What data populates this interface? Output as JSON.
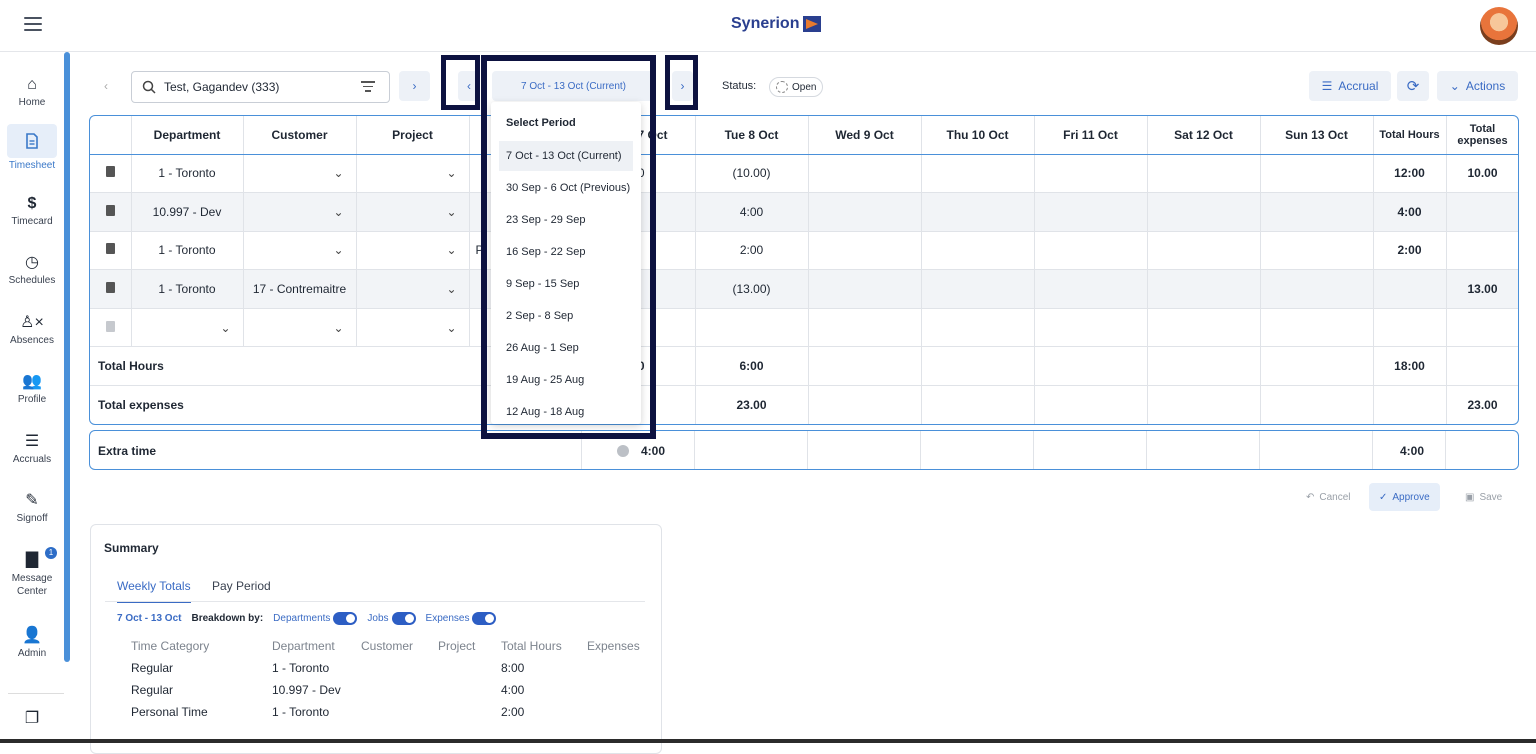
{
  "app": {
    "logo_text": "Synerion"
  },
  "sidebar": {
    "items": [
      {
        "label": "Home",
        "icon": "home-icon"
      },
      {
        "label": "Timesheet",
        "icon": "document-icon"
      },
      {
        "label": "Timecard",
        "icon": "dollar-icon"
      },
      {
        "label": "Schedules",
        "icon": "clock-icon"
      },
      {
        "label": "Absences",
        "icon": "person-x-icon"
      },
      {
        "label": "Profile",
        "icon": "people-icon"
      },
      {
        "label": "Accruals",
        "icon": "accruals-icon"
      },
      {
        "label": "Signoff",
        "icon": "signoff-icon"
      },
      {
        "label": "Message Center",
        "icon": "message-icon",
        "badge": "1"
      },
      {
        "label": "Admin",
        "icon": "admin-icon"
      }
    ]
  },
  "toolbar": {
    "employee_value": "Test, Gagandev (333)",
    "period_label": "7 Oct - 13 Oct (Current)",
    "status_label": "Status:",
    "status_value": "Open",
    "accrual_label": "Accrual",
    "actions_label": "Actions"
  },
  "grid": {
    "headers": [
      "Department",
      "Customer",
      "Project",
      "",
      "Mon 7 Oct",
      "Tue 8 Oct",
      "Wed 9 Oct",
      "Thu 10 Oct",
      "Fri 11 Oct",
      "Sat 12 Oct",
      "Sun 13 Oct",
      "Total Hours",
      "Total expenses"
    ],
    "rows": [
      {
        "department": "1 - Toronto",
        "customer": "",
        "mon": "00",
        "tue": "(10.00)",
        "total_hours": "12:00",
        "total_expenses": "10.00"
      },
      {
        "department": "10.997 - Dev",
        "customer": "",
        "mon": "",
        "tue": "4:00",
        "total_hours": "4:00",
        "total_expenses": ""
      },
      {
        "department": "1 - Toronto",
        "customer": "",
        "extra": "P",
        "mon": "",
        "tue": "2:00",
        "total_hours": "2:00",
        "total_expenses": ""
      },
      {
        "department": "1 - Toronto",
        "customer": "17 - Contremaitre",
        "mon": "",
        "tue": "(13.00)",
        "total_hours": "",
        "total_expenses": "13.00"
      },
      {
        "department": "",
        "customer": "",
        "mon": "",
        "tue": "",
        "total_hours": "",
        "total_expenses": ""
      }
    ],
    "total_hours": {
      "label": "Total Hours",
      "mon": "00",
      "tue": "6:00",
      "total": "18:00"
    },
    "total_expenses": {
      "label": "Total expenses",
      "tue": "23.00",
      "total": "23.00"
    },
    "extra_time": {
      "label": "Extra time",
      "mon": "4:00",
      "total": "4:00"
    }
  },
  "footer_actions": {
    "cancel": "Cancel",
    "approve": "Approve",
    "save": "Save"
  },
  "summary": {
    "title": "Summary",
    "tabs": [
      "Weekly Totals",
      "Pay Period"
    ],
    "period": "7 Oct - 13 Oct",
    "breakdown_label": "Breakdown by:",
    "toggles": [
      "Departments",
      "Jobs",
      "Expenses"
    ],
    "columns": [
      "Time Category",
      "Department",
      "Customer",
      "Project",
      "Total Hours",
      "Expenses"
    ],
    "rows": [
      [
        "Regular",
        "1 - Toronto",
        "",
        "",
        "8:00",
        ""
      ],
      [
        "Regular",
        "10.997 - Dev",
        "",
        "",
        "4:00",
        ""
      ],
      [
        "Personal Time",
        "1 - Toronto",
        "",
        "",
        "2:00",
        ""
      ]
    ]
  },
  "dropdown": {
    "title": "Select Period",
    "options": [
      "7 Oct - 13 Oct (Current)",
      "30 Sep - 6 Oct (Previous)",
      "23 Sep - 29 Sep",
      "16 Sep - 22 Sep",
      "9 Sep - 15 Sep",
      "2 Sep - 8 Sep",
      "26 Aug - 1 Sep",
      "19 Aug - 25 Aug",
      "12 Aug - 18 Aug"
    ],
    "selected": "7 Oct - 13 Oct (Current)"
  },
  "colors": {
    "accent": "#3a6bc4",
    "highlight_frame": "#0d1240",
    "rail": "#4a90d9"
  }
}
